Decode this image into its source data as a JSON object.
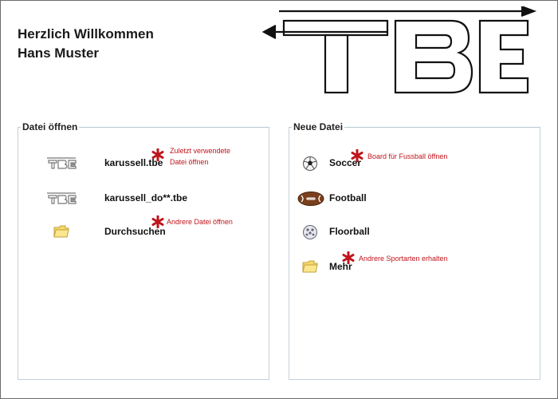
{
  "welcome": {
    "line1": "Herzlich Willkommen",
    "line2": "Hans Muster"
  },
  "logo": {
    "text": "TBE"
  },
  "open_group": {
    "legend": "Datei öffnen",
    "items": [
      {
        "label": "karussell.tbe",
        "icon": "tbe-file-icon",
        "hint": [
          "Zuletzt verwendete",
          "Datei öffnen"
        ]
      },
      {
        "label": "karussell_do**.tbe",
        "icon": "tbe-file-icon"
      },
      {
        "label": "Durchsuchen",
        "icon": "folder-icon",
        "hint": [
          "Andrere Datei öffnen"
        ]
      }
    ]
  },
  "new_group": {
    "legend": "Neue Datei",
    "items": [
      {
        "label": "Soccer",
        "icon": "soccer-ball-icon",
        "hint": [
          "Board für Fussball öffnen"
        ]
      },
      {
        "label": "Football",
        "icon": "american-football-icon"
      },
      {
        "label": "Floorball",
        "icon": "floorball-icon"
      },
      {
        "label": "Mehr",
        "icon": "folder-icon",
        "hint": [
          "Andrere Sportarten erhalten"
        ]
      }
    ]
  },
  "colors": {
    "hint": "#c0141c",
    "border": "#c5d2da",
    "text": "#111111"
  }
}
